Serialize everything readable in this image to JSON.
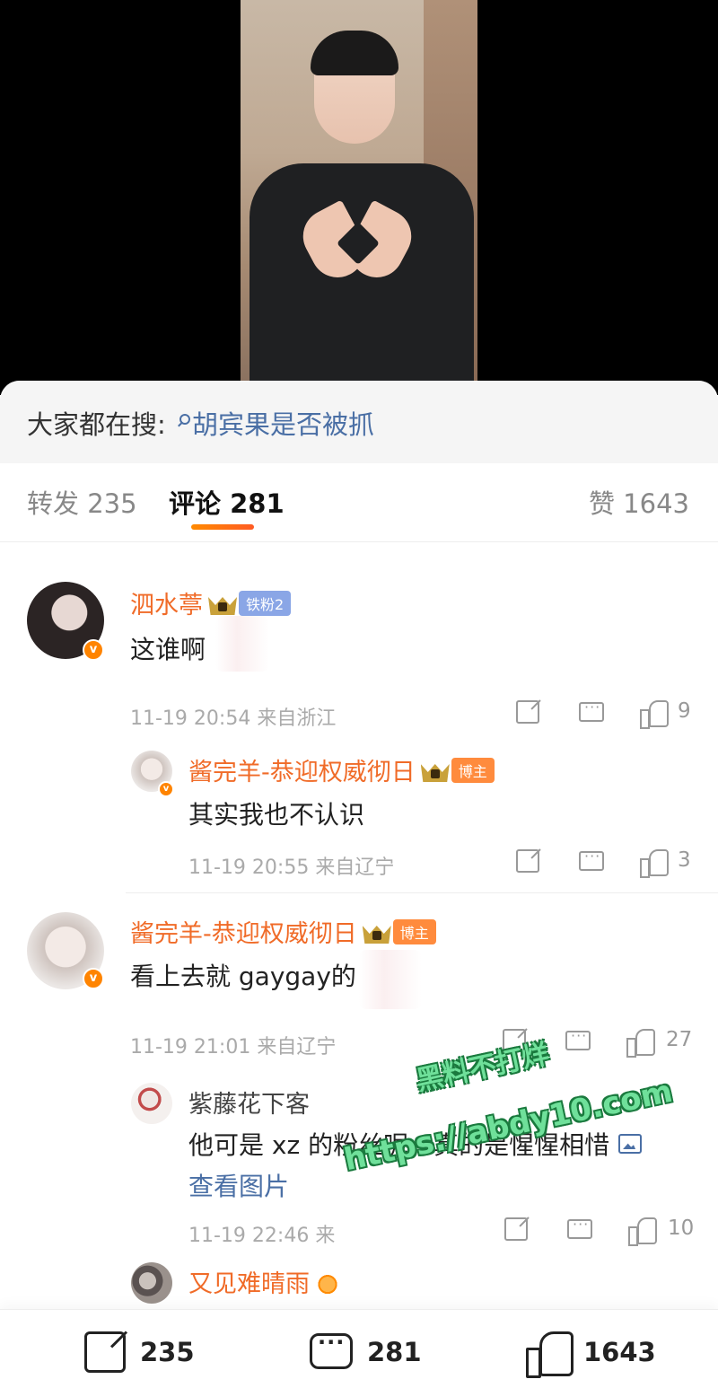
{
  "search": {
    "label": "大家都在搜:",
    "query": "胡宾果是否被抓"
  },
  "tabs": {
    "repost": "转发 235",
    "comment": "评论 281",
    "like": "赞 1643"
  },
  "comments": [
    {
      "user": "泗水葶",
      "tag": "铁粉2",
      "text": "这谁啊",
      "meta": "11-19 20:54 来自浙江",
      "likes": "9",
      "reply": {
        "user": "酱完羊-恭迎权威彻日",
        "tag": "博主",
        "text": "其实我也不认识",
        "meta": "11-19 20:55 来自辽宁",
        "likes": "3"
      }
    },
    {
      "user": "酱完羊-恭迎权威彻日",
      "tag": "博主",
      "text": "看上去就 gaygay的",
      "meta": "11-19 21:01 来自辽宁",
      "likes": "27",
      "reply": {
        "user": "紫藤花下客",
        "text": "他可是 xz 的粉丝呢，真的是惺惺相惜",
        "link": "查看图片",
        "meta": "11-19 22:46 来",
        "likes": "10"
      }
    },
    {
      "user": "又见难晴雨"
    }
  ],
  "watermark": {
    "line1": "黑料不打烊",
    "line2": "https://abdy10.com"
  },
  "bottom_bar": {
    "repost_count": "235",
    "comment_count": "281",
    "like_count": "1643"
  },
  "colors": {
    "username": "#f06b28",
    "link": "#4a6fa5",
    "tab_underline": "#ff6a1a"
  }
}
